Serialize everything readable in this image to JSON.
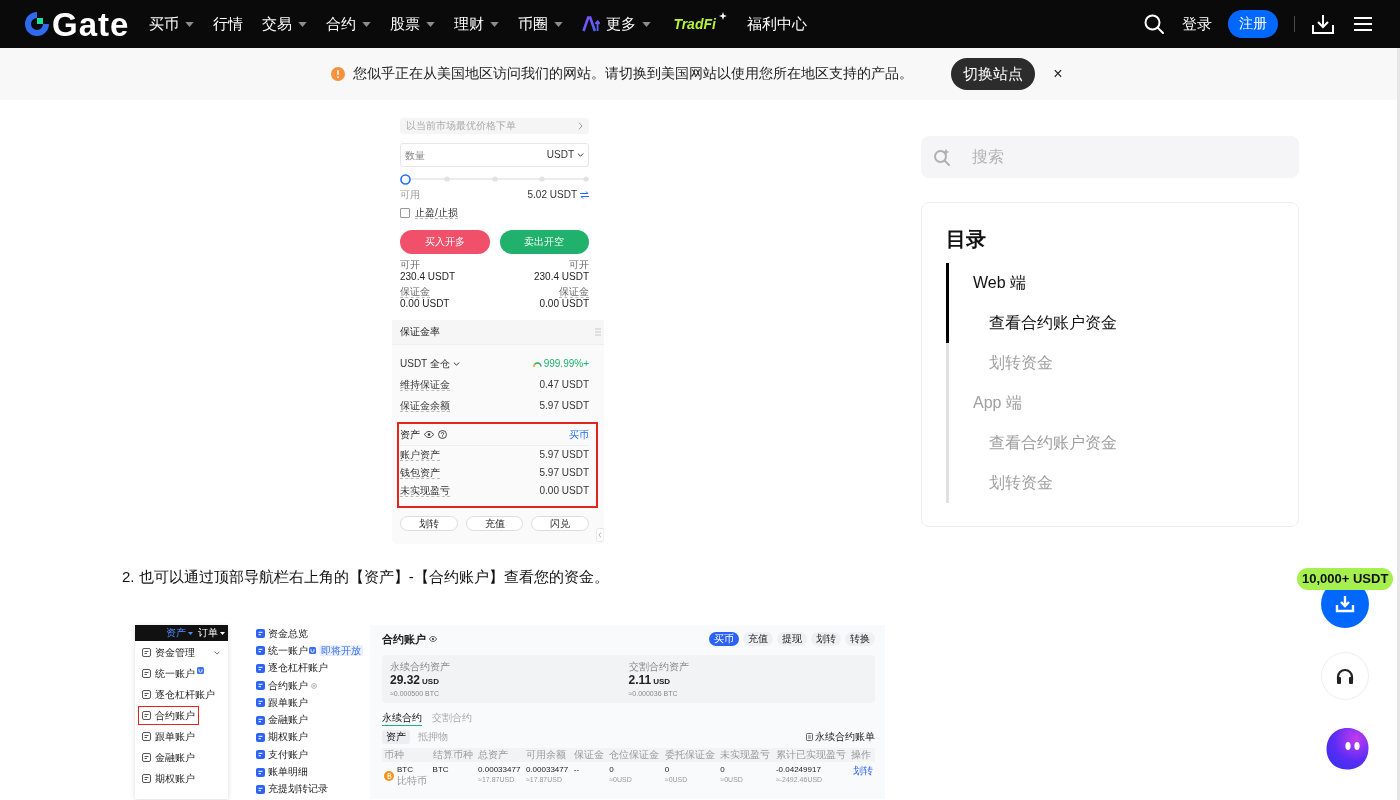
{
  "nav": {
    "logo": "Gate",
    "items": [
      {
        "label": "买币",
        "kind": "text",
        "dropdown": true
      },
      {
        "label": "行情",
        "kind": "text",
        "dropdown": false
      },
      {
        "label": "交易",
        "kind": "text",
        "dropdown": true
      },
      {
        "label": "合约",
        "kind": "text",
        "dropdown": true
      },
      {
        "label": "股票",
        "kind": "text",
        "dropdown": true
      },
      {
        "label": "理财",
        "kind": "text",
        "dropdown": true
      },
      {
        "label": "币圈",
        "kind": "text",
        "dropdown": true
      },
      {
        "label": "更多",
        "kind": "ai",
        "dropdown": true
      },
      {
        "label": "TradFi",
        "kind": "brand",
        "dropdown": false
      },
      {
        "label": "福利中心",
        "kind": "text",
        "dropdown": false
      }
    ],
    "login": "登录",
    "register": "注册"
  },
  "notice": {
    "text": "您似乎正在从美国地区访问我们的网站。请切换到美国网站以使用您所在地区支持的产品。",
    "button": "切换站点",
    "close": "×"
  },
  "article": {
    "trade_panel": {
      "order_hint": "以当前市场最优价格下单",
      "amount": {
        "placeholder": "数量",
        "unit": "USDT"
      },
      "slider": {
        "level": 0
      },
      "available": {
        "label": "可用",
        "value": "5.02 USDT"
      },
      "tpsl": {
        "label": "止盈/止损",
        "checked": false
      },
      "actions": [
        {
          "label": "买入开多",
          "kind": "buy"
        },
        {
          "label": "卖出开空",
          "kind": "sell"
        }
      ],
      "stats": [
        {
          "left": {
            "label": "可开",
            "value": "230.4 USDT"
          },
          "right": {
            "label": "可开",
            "value": "230.4 USDT"
          }
        },
        {
          "left": {
            "label": "保证金",
            "value": "0.00 USDT"
          },
          "right": {
            "label": "保证金",
            "value": "0.00 USDT"
          }
        }
      ],
      "margin": {
        "title": "保证金率",
        "mode": "USDT 全仓",
        "ratio": "999.99%+",
        "rows": [
          {
            "label": "维持保证金",
            "value": "0.47 USDT"
          },
          {
            "label": "保证金余额",
            "value": "5.97 USDT"
          }
        ]
      },
      "assets": {
        "title": "资产",
        "link": "买币",
        "highlighted": true,
        "rows": [
          {
            "label": "账户资产",
            "value": "5.97 USDT"
          },
          {
            "label": "钱包资产",
            "value": "5.97 USDT"
          },
          {
            "label": "未实现盈亏",
            "value": "0.00 USDT"
          }
        ]
      },
      "buttons": [
        "划转",
        "充值",
        "闪兑"
      ]
    },
    "step_text": "2. 也可以通过顶部导航栏右上角的【资产】-【合约账户】查看您的资金。",
    "assets_screenshot": {
      "top_bar": [
        {
          "label": "资产",
          "selected": true
        },
        {
          "label": "订单",
          "selected": false
        }
      ],
      "menu": [
        {
          "label": "资金管理",
          "expandable": true,
          "badge": false,
          "highlighted": false
        },
        {
          "label": "统一账户",
          "expandable": false,
          "badge": true,
          "highlighted": false
        },
        {
          "label": "逐仓杠杆账户",
          "expandable": false,
          "badge": false,
          "highlighted": false
        },
        {
          "label": "合约账户",
          "expandable": false,
          "badge": false,
          "highlighted": true
        },
        {
          "label": "跟单账户",
          "expandable": false,
          "badge": false,
          "highlighted": false
        },
        {
          "label": "金融账户",
          "expandable": false,
          "badge": false,
          "highlighted": false
        },
        {
          "label": "期权账户",
          "expandable": false,
          "badge": false,
          "highlighted": false
        }
      ],
      "accounts": [
        {
          "label": "资金总览",
          "badge": false,
          "status_icon": false
        },
        {
          "label": "统一账户",
          "badge": true,
          "status_icon": false,
          "tag": "即将开放"
        },
        {
          "label": "逐仓杠杆账户",
          "badge": false,
          "status_icon": false
        },
        {
          "label": "合约账户",
          "badge": false,
          "status_icon": true
        },
        {
          "label": "跟单账户",
          "badge": false,
          "status_icon": false
        },
        {
          "label": "金融账户",
          "badge": false,
          "status_icon": false
        },
        {
          "label": "期权账户",
          "badge": false,
          "status_icon": false
        },
        {
          "label": "支付账户",
          "badge": false,
          "status_icon": false
        },
        {
          "label": "账单明细",
          "badge": false,
          "status_icon": false
        },
        {
          "label": "充提划转记录",
          "badge": false,
          "status_icon": false
        }
      ],
      "page": {
        "title": "合约账户",
        "buttons": [
          {
            "label": "买币",
            "primary": true
          },
          {
            "label": "充值",
            "primary": false
          },
          {
            "label": "提现",
            "primary": false
          },
          {
            "label": "划转",
            "primary": false
          },
          {
            "label": "转换",
            "primary": false
          }
        ],
        "summary": [
          {
            "label": "永续合约资产",
            "amount": "29.32",
            "unit": "USD",
            "approx": "≈0.000500 BTC"
          },
          {
            "label": "交割合约资产",
            "amount": "2.11",
            "unit": "USD",
            "approx": "≈0.000036 BTC"
          }
        ],
        "tabs": [
          {
            "label": "永续合约",
            "selected": true
          },
          {
            "label": "交割合约",
            "selected": false
          }
        ],
        "sub_tabs": [
          {
            "label": "资产",
            "selected": true
          },
          {
            "label": "抵押物",
            "selected": false
          }
        ],
        "bill_link": "永续合约账单",
        "columns": [
          "币种",
          "结算币种",
          "总资产",
          "可用余额",
          "保证金",
          "仓位保证金",
          "委托保证金",
          "未实现盈亏",
          "累计已实现盈亏",
          "操作"
        ],
        "rows": [
          {
            "cells": [
              {
                "kind": "coin",
                "value": "BTC",
                "sub": "比特币"
              },
              {
                "kind": "text",
                "value": "BTC"
              },
              {
                "kind": "text",
                "value": "0.00033477",
                "sub": "≈17.87USD"
              },
              {
                "kind": "text",
                "value": "0.00033477",
                "sub": "≈17.87USD"
              },
              {
                "kind": "text",
                "value": "--"
              },
              {
                "kind": "text",
                "value": "0",
                "sub": "≈0USD"
              },
              {
                "kind": "text",
                "value": "0",
                "sub": "≈0USD"
              },
              {
                "kind": "text",
                "value": "0",
                "sub": "≈0USD"
              },
              {
                "kind": "text",
                "value": "-0.04249917",
                "sub": "≈-2492.46USD"
              },
              {
                "kind": "action",
                "value": "划转"
              }
            ]
          }
        ]
      }
    }
  },
  "sidebar": {
    "search": {
      "placeholder": "搜索"
    },
    "toc": {
      "title": "目录",
      "items": [
        {
          "label": "Web 端",
          "selected": true,
          "children": [
            {
              "label": "查看合约账户资金",
              "selected": true
            },
            {
              "label": "划转资金",
              "selected": false
            }
          ]
        },
        {
          "label": "App 端",
          "selected": false,
          "children": [
            {
              "label": "查看合约账户资金",
              "selected": false
            },
            {
              "label": "划转资金",
              "selected": false
            }
          ]
        }
      ]
    }
  },
  "floating": {
    "badge": "10,000+ USDT"
  }
}
